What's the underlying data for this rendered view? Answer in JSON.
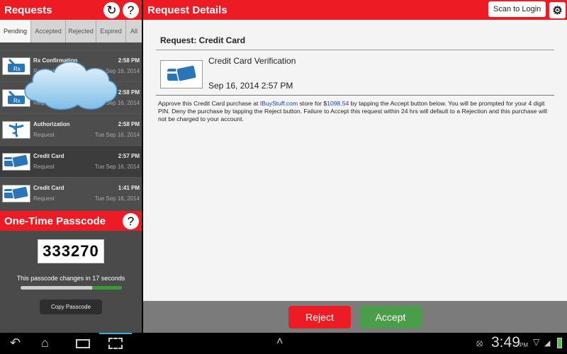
{
  "left": {
    "title": "Requests",
    "refresh_icon": "refresh-icon",
    "help_icon": "help-icon",
    "tabs": [
      "Pending",
      "Accepted",
      "Rejected",
      "Expired",
      "All"
    ],
    "items": [
      {
        "title": "Rx Confirmation",
        "subtitle": "Request",
        "time": "2:58 PM",
        "date": "Tue Sep 16, 2014",
        "icon": "rx-icon"
      },
      {
        "title": "Rx Confirmation",
        "subtitle": "Request",
        "time": "2:58 PM",
        "date": "Tue Sep 16, 2014",
        "icon": "rx-icon"
      },
      {
        "title": "Authorization",
        "subtitle": "Request",
        "time": "2:58 PM",
        "date": "Tue Sep 16, 2014",
        "icon": "caduceus-icon"
      },
      {
        "title": "Credit Card",
        "subtitle": "Request",
        "time": "2:57 PM",
        "date": "Tue Sep 16, 2014",
        "icon": "credit-card-icon"
      },
      {
        "title": "Credit Card",
        "subtitle": "Request",
        "time": "1:41 PM",
        "date": "Tue Sep 16, 2014",
        "icon": "credit-card-icon"
      }
    ]
  },
  "otp": {
    "title": "One-Time Passcode",
    "code": "333270",
    "message": "This passcode changes in 17 seconds",
    "progress_fraction": 0.71,
    "copy_label": "Copy Passcode"
  },
  "detail": {
    "title": "Request Details",
    "scan_label": "Scan to Login",
    "request_heading": "Request: Credit Card",
    "name": "Credit Card Verification",
    "datetime": "Sep 16, 2014 2:57 PM",
    "desc_1": "Approve this Credit Card purchase at ",
    "store": "IBuyStuff.com",
    "desc_2": " store for $",
    "amount": "1098.54",
    "desc_3": " by tapping the Accept button below. You will be prompted for your 4 digit PIN. Deny the purchase by tapping the Reject button. Failure to Accept this request within 24 hrs will default to a Rejection and this purchase will not be charged to your account.",
    "reject_label": "Reject",
    "accept_label": "Accept"
  },
  "colors": {
    "red": "#ed1c24",
    "green": "#4a9e4a"
  },
  "statusbar": {
    "time": "3:49",
    "ampm": "PM"
  }
}
